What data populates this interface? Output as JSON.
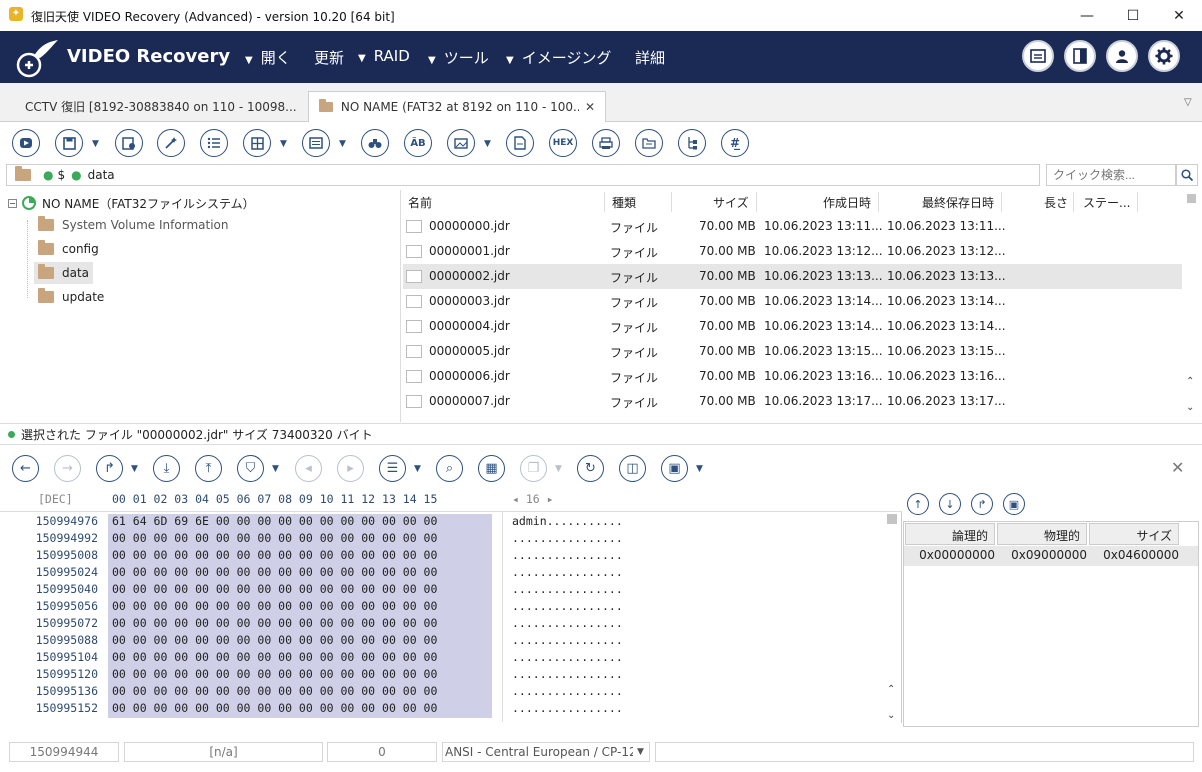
{
  "window": {
    "title": "復旧天使 VIDEO Recovery (Advanced) - version 10.20 [64 bit]",
    "controls": {
      "minimize": "—",
      "maximize": "☐",
      "close": "✕"
    }
  },
  "menubar": {
    "app_name": "VIDEO Recovery",
    "items": [
      {
        "label": "開く",
        "has_dropdown": true
      },
      {
        "label": "更新",
        "has_dropdown": true
      },
      {
        "label": "RAID",
        "has_dropdown": true
      },
      {
        "label": "ツール",
        "has_dropdown": true
      },
      {
        "label": "イメージング",
        "has_dropdown": false
      },
      {
        "label": "詳細",
        "has_dropdown": false
      }
    ],
    "right_icons": [
      "panel-icon",
      "layout-icon",
      "user-icon",
      "gear-icon"
    ]
  },
  "tabs": [
    {
      "label": "CCTV 復旧 [8192-30883840 on 110 - 10098...",
      "active": false,
      "icon": "red-dot-icon"
    },
    {
      "label": "NO NAME (FAT32 at 8192 on 110 - 100...",
      "active": true,
      "icon": "folder-icon",
      "close": "✕"
    }
  ],
  "toolbar": {
    "buttons": [
      {
        "name": "play-button",
        "glyph": "▶"
      },
      {
        "name": "save-button",
        "glyph": "💾",
        "dropdown": true
      },
      {
        "name": "save-special-button",
        "glyph": "⚙"
      },
      {
        "name": "wand-button",
        "glyph": "✎"
      },
      {
        "name": "list-button",
        "glyph": "☰"
      },
      {
        "name": "grid-button",
        "glyph": "▦",
        "dropdown": true
      },
      {
        "name": "view-button",
        "glyph": "▤",
        "dropdown": true
      },
      {
        "name": "find-button",
        "glyph": "⌕"
      },
      {
        "name": "ab-button",
        "glyph": "ÃB"
      },
      {
        "name": "image-button",
        "glyph": "▣",
        "dropdown": true
      },
      {
        "name": "file-button",
        "glyph": "▢"
      },
      {
        "name": "hex-button",
        "glyph": "HEX"
      },
      {
        "name": "print-button",
        "glyph": "⎙"
      },
      {
        "name": "folder-open-button",
        "glyph": "⤳"
      },
      {
        "name": "tree-button",
        "glyph": "⋮"
      },
      {
        "name": "hash-button",
        "glyph": "#"
      }
    ]
  },
  "path": {
    "root": "$",
    "folder": "data"
  },
  "search": {
    "placeholder": "クイック検索..."
  },
  "tree": {
    "root": "NO NAME（FAT32ファイルシステム）",
    "children": [
      "System Volume Information",
      "config",
      "data",
      "update"
    ],
    "selected": "data"
  },
  "filelist": {
    "columns": [
      "名前",
      "種類",
      "サイズ",
      "作成日時",
      "最終保存日時",
      "長さ",
      "ステー..."
    ],
    "rows": [
      {
        "name": "00000000.jdr",
        "type": "ファイル",
        "size": "70.00 MB",
        "created": "10.06.2023 13:11...",
        "modified": "10.06.2023 13:11..."
      },
      {
        "name": "00000001.jdr",
        "type": "ファイル",
        "size": "70.00 MB",
        "created": "10.06.2023 13:12...",
        "modified": "10.06.2023 13:12..."
      },
      {
        "name": "00000002.jdr",
        "type": "ファイル",
        "size": "70.00 MB",
        "created": "10.06.2023 13:13...",
        "modified": "10.06.2023 13:13..."
      },
      {
        "name": "00000003.jdr",
        "type": "ファイル",
        "size": "70.00 MB",
        "created": "10.06.2023 13:14...",
        "modified": "10.06.2023 13:14..."
      },
      {
        "name": "00000004.jdr",
        "type": "ファイル",
        "size": "70.00 MB",
        "created": "10.06.2023 13:14...",
        "modified": "10.06.2023 13:14..."
      },
      {
        "name": "00000005.jdr",
        "type": "ファイル",
        "size": "70.00 MB",
        "created": "10.06.2023 13:15...",
        "modified": "10.06.2023 13:15..."
      },
      {
        "name": "00000006.jdr",
        "type": "ファイル",
        "size": "70.00 MB",
        "created": "10.06.2023 13:16...",
        "modified": "10.06.2023 13:16..."
      },
      {
        "name": "00000007.jdr",
        "type": "ファイル",
        "size": "70.00 MB",
        "created": "10.06.2023 13:17...",
        "modified": "10.06.2023 13:17..."
      }
    ],
    "selected_index": 2
  },
  "status": {
    "selected_text": "選択された ファイル \"00000002.jdr\" サイズ 73400320 バイト"
  },
  "hex": {
    "radix": "[DEC]",
    "columns": "00 01 02 03 04 05 06 07 08 09 10 11 12 13 14 15",
    "page_nav": "◂ 16 ▸",
    "rows": [
      {
        "offset": "150994976",
        "hex": "61 64 6D 69 6E 00 00 00 00 00 00 00 00 00 00 00",
        "ascii": "admin..........."
      },
      {
        "offset": "150994992",
        "hex": "00 00 00 00 00 00 00 00 00 00 00 00 00 00 00 00",
        "ascii": "................"
      },
      {
        "offset": "150995008",
        "hex": "00 00 00 00 00 00 00 00 00 00 00 00 00 00 00 00",
        "ascii": "................"
      },
      {
        "offset": "150995024",
        "hex": "00 00 00 00 00 00 00 00 00 00 00 00 00 00 00 00",
        "ascii": "................"
      },
      {
        "offset": "150995040",
        "hex": "00 00 00 00 00 00 00 00 00 00 00 00 00 00 00 00",
        "ascii": "................"
      },
      {
        "offset": "150995056",
        "hex": "00 00 00 00 00 00 00 00 00 00 00 00 00 00 00 00",
        "ascii": "................"
      },
      {
        "offset": "150995072",
        "hex": "00 00 00 00 00 00 00 00 00 00 00 00 00 00 00 00",
        "ascii": "................"
      },
      {
        "offset": "150995088",
        "hex": "00 00 00 00 00 00 00 00 00 00 00 00 00 00 00 00",
        "ascii": "................"
      },
      {
        "offset": "150995104",
        "hex": "00 00 00 00 00 00 00 00 00 00 00 00 00 00 00 00",
        "ascii": "................"
      },
      {
        "offset": "150995120",
        "hex": "00 00 00 00 00 00 00 00 00 00 00 00 00 00 00 00",
        "ascii": "................"
      },
      {
        "offset": "150995136",
        "hex": "00 00 00 00 00 00 00 00 00 00 00 00 00 00 00 00",
        "ascii": "................"
      },
      {
        "offset": "150995152",
        "hex": "00 00 00 00 00 00 00 00 00 00 00 00 00 00 00 00",
        "ascii": "................"
      }
    ]
  },
  "mapping": {
    "columns": [
      "論理的",
      "物理的",
      "サイズ"
    ],
    "rows": [
      {
        "logical": "0x00000000",
        "physical": "0x09000000",
        "size": "0x04600000"
      }
    ]
  },
  "bottom": {
    "position": "150994944",
    "value": "[n/a]",
    "count": "0",
    "encoding": "ANSI - Central European / CP-12"
  },
  "colors": {
    "navy": "#1a2a55",
    "accent": "#2d5080",
    "hex_highlight": "#cfcfe8"
  }
}
